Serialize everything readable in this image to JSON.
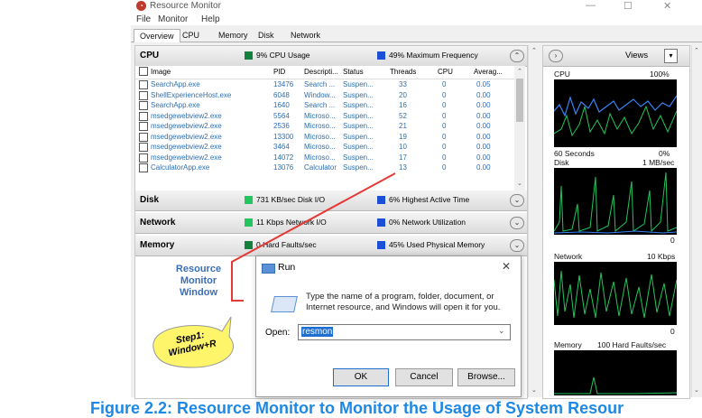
{
  "window": {
    "title": "Resource Monitor",
    "minimize": "—",
    "maximize": "☐",
    "close": "✕"
  },
  "menu": [
    "File",
    "Monitor",
    "Help"
  ],
  "tabs": [
    "Overview",
    "CPU",
    "Memory",
    "Disk",
    "Network"
  ],
  "cpu": {
    "title": "CPU",
    "usage": "9% CPU Usage",
    "frequency": "49% Maximum Frequency",
    "columns": [
      "Image",
      "PID",
      "Descripti...",
      "Status",
      "Threads",
      "CPU",
      "Averag..."
    ],
    "rows": [
      [
        "SearchApp.exe",
        "13476",
        "Search ...",
        "Suspen...",
        "33",
        "0",
        "0.05"
      ],
      [
        "ShellExperienceHost.exe",
        "6048",
        "Window...",
        "Suspen...",
        "20",
        "0",
        "0.00"
      ],
      [
        "SearchApp.exe",
        "1640",
        "Search ...",
        "Suspen...",
        "16",
        "0",
        "0.00"
      ],
      [
        "msedgewebview2.exe",
        "5564",
        "Microso...",
        "Suspen...",
        "52",
        "0",
        "0.00"
      ],
      [
        "msedgewebview2.exe",
        "2536",
        "Microso...",
        "Suspen...",
        "21",
        "0",
        "0.00"
      ],
      [
        "msedgewebview2.exe",
        "13300",
        "Microso...",
        "Suspen...",
        "19",
        "0",
        "0.00"
      ],
      [
        "msedgewebview2.exe",
        "3464",
        "Microso...",
        "Suspen...",
        "10",
        "0",
        "0.00"
      ],
      [
        "msedgewebview2.exe",
        "14072",
        "Microso...",
        "Suspen...",
        "17",
        "0",
        "0.00"
      ],
      [
        "CalculatorApp.exe",
        "13076",
        "Calculator",
        "Suspen...",
        "13",
        "0",
        "0.00"
      ]
    ]
  },
  "disk": {
    "title": "Disk",
    "io": "731 KB/sec Disk I/O",
    "active": "6% Highest Active Time"
  },
  "network": {
    "title": "Network",
    "io": "11 Kbps Network I/O",
    "util": "0% Network Utilization"
  },
  "memory": {
    "title": "Memory",
    "faults": "0 Hard Faults/sec",
    "used": "45% Used Physical Memory"
  },
  "right": {
    "views": "Views",
    "cpu_label": "CPU",
    "cpu_max": "100%",
    "seconds": "60 Seconds",
    "cpu_min": "0%",
    "disk_label": "Disk",
    "disk_max": "1 MB/sec",
    "disk_min": "0",
    "net_label": "Network",
    "net_max": "10 Kbps",
    "net_min": "0",
    "mem_label": "Memory",
    "mem_max": "100 Hard Faults/sec"
  },
  "annotation": {
    "label": "Resource Monitor Window",
    "bubble_line1": "Step1:",
    "bubble_line2": "Window+R"
  },
  "run": {
    "title": "Run",
    "description": "Type the name of a program, folder, document, or Internet resource, and Windows will open it for you.",
    "open_label": "Open:",
    "value": "resmon",
    "ok": "OK",
    "cancel": "Cancel",
    "browse": "Browse..."
  },
  "caption": "Figure 2.2: Resource Monitor to Monitor the Usage of System Resour",
  "colors": {
    "accent": "#1e88e5",
    "graph_green": "#22c55e",
    "graph_blue": "#3b82f6",
    "arrow": "#e53935"
  }
}
